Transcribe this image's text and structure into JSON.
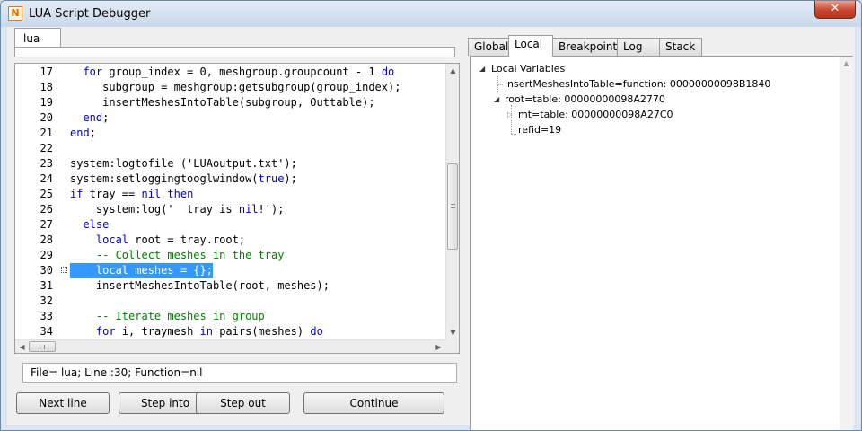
{
  "window": {
    "title": "LUA Script Debugger",
    "icon_letter": "N",
    "close_symbol": "✕"
  },
  "editor": {
    "file_tab": "lua",
    "line_numbers": [
      "17",
      "18",
      "19",
      "20",
      "21",
      "22",
      "23",
      "24",
      "25",
      "26",
      "27",
      "28",
      "29",
      "30",
      "31",
      "32",
      "33",
      "34"
    ],
    "highlighted_line": "30",
    "code_lines": [
      [
        {
          "t": "  "
        },
        {
          "t": "for",
          "k": "kw"
        },
        {
          "t": " group_index = 0, meshgroup.groupcount - 1 "
        },
        {
          "t": "do",
          "k": "kw"
        }
      ],
      [
        {
          "t": "     subgroup = meshgroup:getsubgroup(group_index);"
        }
      ],
      [
        {
          "t": "     insertMeshesIntoTable(subgroup, Outtable);"
        }
      ],
      [
        {
          "t": "  "
        },
        {
          "t": "end",
          "k": "kw"
        },
        {
          "t": ";"
        }
      ],
      [
        {
          "t": "end",
          "k": "kw"
        },
        {
          "t": ";"
        }
      ],
      [
        {
          "t": ""
        }
      ],
      [
        {
          "t": "system:logtofile ('LUAoutput.txt');"
        }
      ],
      [
        {
          "t": "system:setloggingtooglwindow("
        },
        {
          "t": "true",
          "k": "kw"
        },
        {
          "t": ");"
        }
      ],
      [
        {
          "t": "if",
          "k": "kw"
        },
        {
          "t": " tray == "
        },
        {
          "t": "nil",
          "k": "kw"
        },
        {
          "t": " "
        },
        {
          "t": "then",
          "k": "kw"
        }
      ],
      [
        {
          "t": "    system:log('  tray is "
        },
        {
          "t": "nil",
          "k": "kw"
        },
        {
          "t": "!');"
        }
      ],
      [
        {
          "t": "  "
        },
        {
          "t": "else",
          "k": "kw"
        }
      ],
      [
        {
          "t": "    "
        },
        {
          "t": "local",
          "k": "kw"
        },
        {
          "t": " root = tray.root;"
        }
      ],
      [
        {
          "t": "    "
        },
        {
          "t": "-- Collect meshes in the tray",
          "k": "cm"
        }
      ],
      [
        {
          "t": "    local meshes = {};",
          "k": "sel"
        }
      ],
      [
        {
          "t": "    insertMeshesIntoTable(root, meshes);"
        }
      ],
      [
        {
          "t": ""
        }
      ],
      [
        {
          "t": "    "
        },
        {
          "t": "-- Iterate meshes in group",
          "k": "cm"
        }
      ],
      [
        {
          "t": "    "
        },
        {
          "t": "for",
          "k": "kw"
        },
        {
          "t": " i, traymesh "
        },
        {
          "t": "in",
          "k": "kw"
        },
        {
          "t": " pairs(meshes) "
        },
        {
          "t": "do",
          "k": "kw"
        }
      ]
    ],
    "status": "File= lua; Line :30; Function=nil"
  },
  "buttons": {
    "next_line": "Next line",
    "step_into": "Step into",
    "step_out": "Step out",
    "continue": "Continue"
  },
  "tabs": [
    "Global",
    "Local",
    "Breakpoints",
    "Log",
    "Stack"
  ],
  "active_tab": "Local",
  "tree": {
    "root_label": "Local Variables",
    "items": [
      "insertMeshesIntoTable=function: 00000000098B1840",
      "root=table: 00000000098A2770",
      "mt=table: 00000000098A27C0",
      "refid=19"
    ]
  },
  "glyphs": {
    "arrow_up": "▲",
    "arrow_down": "▼",
    "arrow_left": "◀",
    "arrow_right": "▶",
    "expanded": "◢",
    "collapsed": "▷"
  }
}
